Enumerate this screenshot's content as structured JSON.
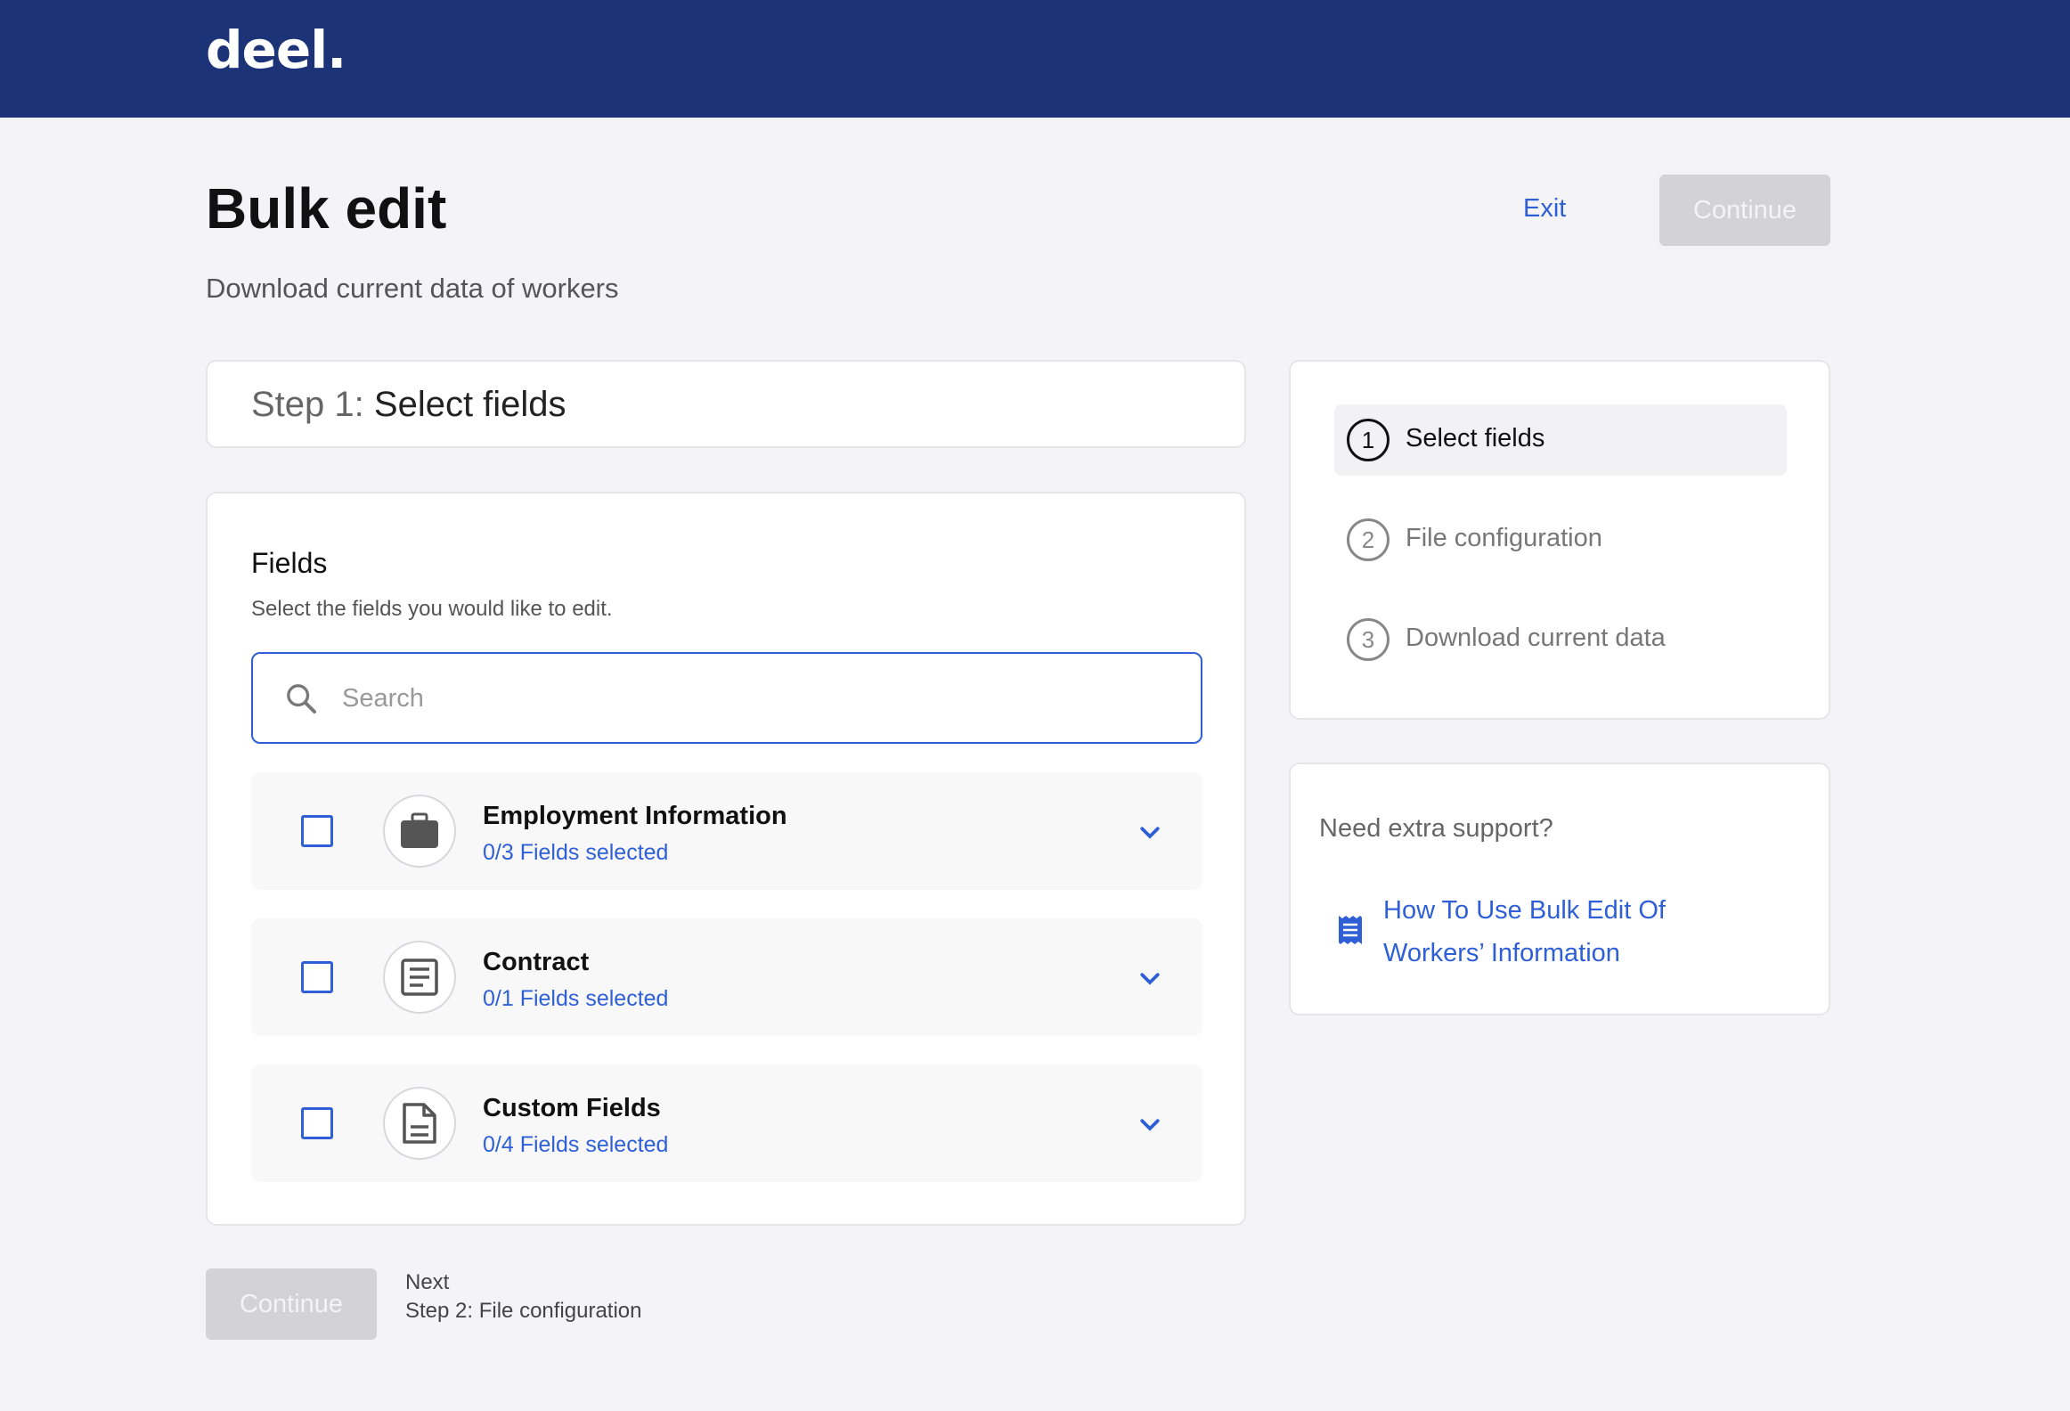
{
  "header": {
    "logo": "deel."
  },
  "page": {
    "title": "Bulk edit",
    "subtitle": "Download current data of workers",
    "exit_label": "Exit",
    "continue_label": "Continue"
  },
  "step": {
    "prefix": "Step 1:",
    "name": "Select fields"
  },
  "fields": {
    "heading": "Fields",
    "description": "Select the fields you would like to edit.",
    "search_placeholder": "Search",
    "groups": [
      {
        "title": "Employment Information",
        "selected": "0/3 Fields selected",
        "icon": "briefcase-icon"
      },
      {
        "title": "Contract",
        "selected": "0/1 Fields selected",
        "icon": "contract-icon"
      },
      {
        "title": "Custom Fields",
        "selected": "0/4 Fields selected",
        "icon": "file-icon"
      }
    ]
  },
  "progress": {
    "steps": [
      {
        "num": "1",
        "label": "Select fields"
      },
      {
        "num": "2",
        "label": "File configuration"
      },
      {
        "num": "3",
        "label": "Download current data"
      }
    ]
  },
  "support": {
    "title": "Need extra support?",
    "link": "How To Use Bulk Edit Of Workers’ Information"
  },
  "footer": {
    "continue_label": "Continue",
    "next_label": "Next",
    "next_step": "Step 2: File configuration"
  },
  "colors": {
    "header_bg": "#1d3378",
    "accent": "#2f5fd6",
    "disabled_button": "#d3d3d5"
  }
}
